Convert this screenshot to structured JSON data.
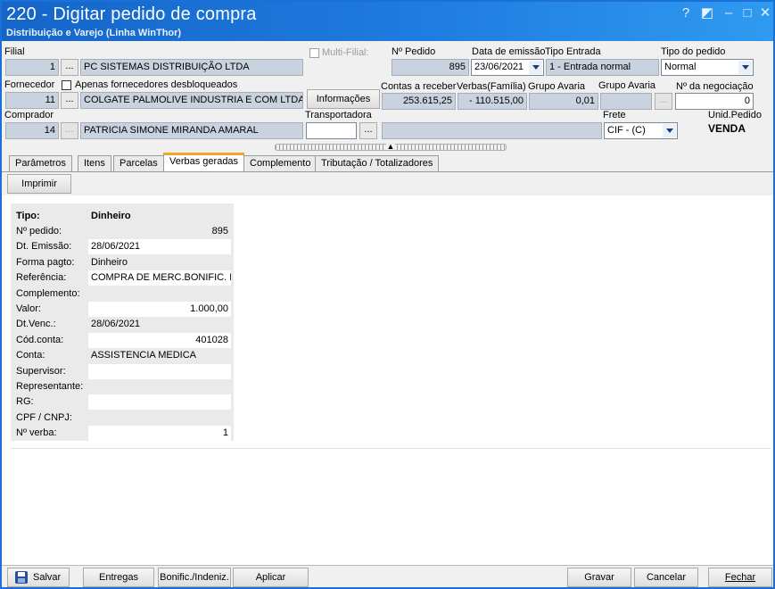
{
  "window": {
    "title": "220 - Digitar pedido de compra",
    "subtitle": "Distribuição e Varejo (Linha WinThor)",
    "help": "?",
    "restore": "◩",
    "minimize": "–",
    "maximize": "□",
    "close": "✕"
  },
  "header": {
    "filial": {
      "label": "Filial",
      "code": "1",
      "name": "PC SISTEMAS DISTRIBUIÇÃO LTDA"
    },
    "multi_filial": {
      "label": "Multi-Filial:",
      "checked": false
    },
    "pedido": {
      "label": "Nº Pedido",
      "value": "895"
    },
    "data_emissao": {
      "label": "Data de emissão",
      "value": "23/06/2021"
    },
    "tipo_entrada": {
      "label": "Tipo Entrada",
      "value": "1 - Entrada normal"
    },
    "tipo_pedido": {
      "label": "Tipo do pedido",
      "value": "Normal"
    },
    "fornecedor": {
      "label": "Fornecedor",
      "code": "11",
      "name": "COLGATE PALMOLIVE INDUSTRIA  E COM LTDA"
    },
    "apenas_desbloqueados": {
      "label": "Apenas fornecedores desbloqueados",
      "checked": false
    },
    "informacoes_button": "Informações",
    "contas_receber": {
      "label": "Contas a receber",
      "value": "253.615,25"
    },
    "verbas_familia": {
      "label": "Verbas(Família)",
      "value": "- 110.515,00"
    },
    "grupo_avaria_1": {
      "label": "Grupo Avaria",
      "value": "0,01"
    },
    "grupo_avaria_2": {
      "label": "Grupo Avaria",
      "value": ""
    },
    "negociacao": {
      "label": "Nº da negociação",
      "value": "0"
    },
    "comprador": {
      "label": "Comprador",
      "code": "14",
      "name": "PATRICIA SIMONE MIRANDA AMARAL"
    },
    "transportadora": {
      "label": "Transportadora",
      "code": "",
      "name": ""
    },
    "frete": {
      "label": "Frete",
      "value": "CIF - (C)"
    },
    "unid_pedido": {
      "label": "Unid.Pedido",
      "value": "VENDA"
    },
    "dots": "..."
  },
  "tabs": [
    {
      "label": "Parâmetros",
      "active": false
    },
    {
      "label": "Itens",
      "active": false
    },
    {
      "label": "Parcelas",
      "active": false
    },
    {
      "label": "Verbas geradas",
      "active": true
    },
    {
      "label": "Complemento",
      "active": false
    },
    {
      "label": "Tributação / Totalizadores",
      "active": false
    }
  ],
  "toolbar": {
    "imprimir": "Imprimir"
  },
  "verba_grid": {
    "tipo_label": "Tipo:",
    "tipo_value": "Dinheiro",
    "rows": [
      {
        "label": "Nº pedido:",
        "value": "895",
        "align": "right"
      },
      {
        "label": "Dt. Emissão:",
        "value": "28/06/2021",
        "align": "left"
      },
      {
        "label": "Forma pagto:",
        "value": "Dinheiro",
        "align": "left"
      },
      {
        "label": "Referência:",
        "value": "COMPRA DE MERC.BONIFIC. Nº",
        "align": "left"
      },
      {
        "label": "Complemento:",
        "value": "",
        "align": "left"
      },
      {
        "label": "Valor:",
        "value": "1.000,00",
        "align": "right"
      },
      {
        "label": "Dt.Venc.:",
        "value": "28/06/2021",
        "align": "left"
      },
      {
        "label": "Cód.conta:",
        "value": "401028",
        "align": "right"
      },
      {
        "label": "Conta:",
        "value": "ASSISTENCIA MEDICA",
        "align": "left"
      },
      {
        "label": "Supervisor:",
        "value": "",
        "align": "left"
      },
      {
        "label": "Representante:",
        "value": "",
        "align": "left"
      },
      {
        "label": "RG:",
        "value": "",
        "align": "left"
      },
      {
        "label": "CPF / CNPJ:",
        "value": "",
        "align": "left"
      },
      {
        "label": "Nº verba:",
        "value": "1",
        "align": "right"
      }
    ]
  },
  "footer": {
    "salvar": "Salvar",
    "entregas": "Entregas",
    "bonific": "Bonific./Indeniz.",
    "aplicar": "Aplicar",
    "gravar": "Gravar",
    "cancelar": "Cancelar",
    "fechar": "Fechar"
  },
  "colors": {
    "title_bar": "#1565c7",
    "field_readonly": "#c9d3df",
    "active_tab_accent": "#f3a62e"
  }
}
